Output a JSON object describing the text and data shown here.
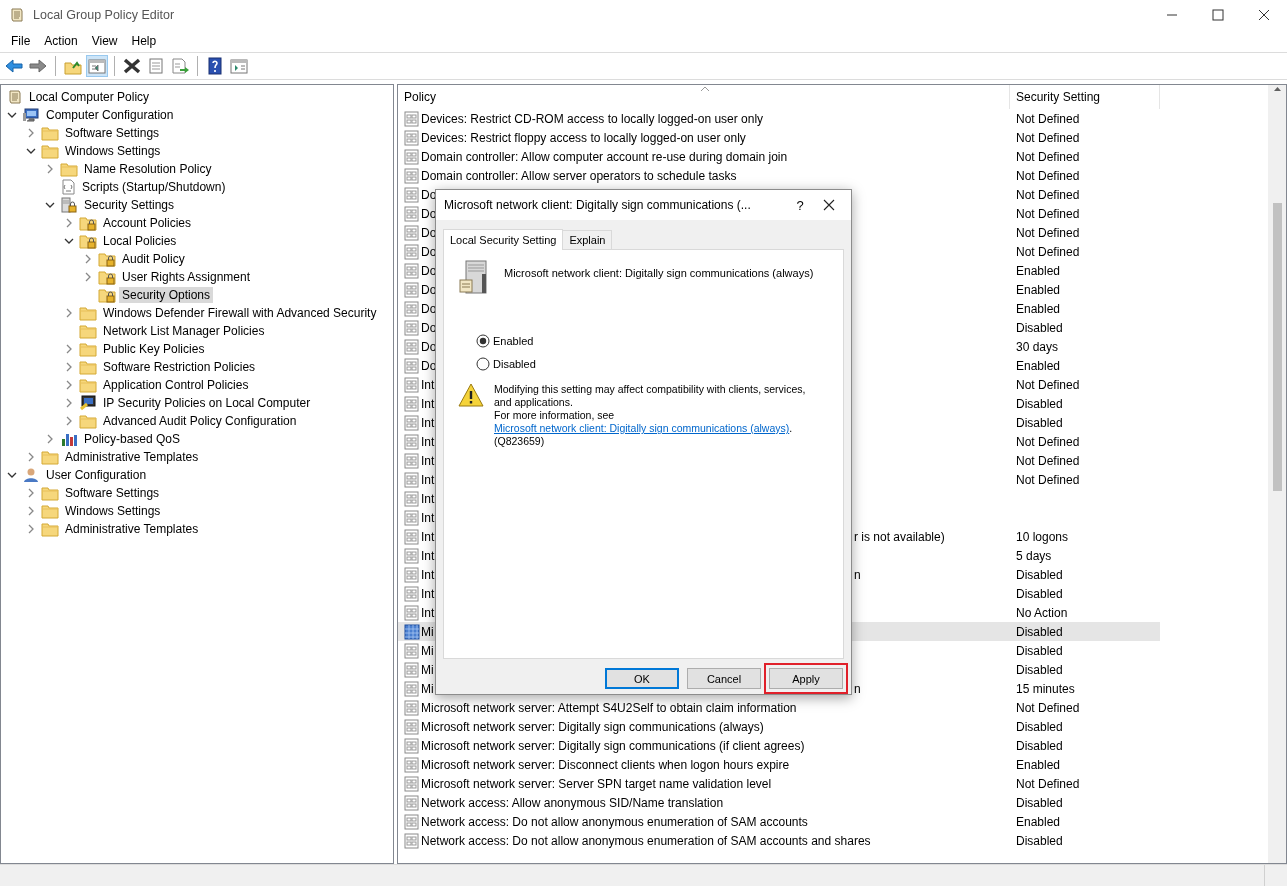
{
  "window": {
    "title": "Local Group Policy Editor"
  },
  "menu": [
    "File",
    "Action",
    "View",
    "Help"
  ],
  "toolbar": [
    [
      {
        "kind": "back",
        "pressed": false
      },
      {
        "kind": "forward",
        "pressed": false
      }
    ],
    [
      {
        "kind": "up",
        "pressed": false
      },
      {
        "kind": "tree",
        "pressed": true
      }
    ],
    [
      {
        "kind": "delete",
        "pressed": false
      },
      {
        "kind": "properties",
        "pressed": false
      },
      {
        "kind": "export",
        "pressed": false
      }
    ],
    [
      {
        "kind": "help",
        "pressed": false
      },
      {
        "kind": "view",
        "pressed": false
      }
    ]
  ],
  "tree": [
    {
      "label": "Local Computer Policy",
      "kind": "policy-root",
      "selected": false,
      "children": [
        {
          "label": "Computer Configuration",
          "kind": "computer",
          "expanded": true,
          "selected": false,
          "children": [
            {
              "label": "Software Settings",
              "kind": "folder",
              "expanded": false,
              "selected": false
            },
            {
              "label": "Windows Settings",
              "kind": "folder",
              "expanded": true,
              "selected": false,
              "children": [
                {
                  "label": "Name Resolution Policy",
                  "kind": "folder",
                  "expanded": false,
                  "selected": false
                },
                {
                  "label": "Scripts (Startup/Shutdown)",
                  "kind": "scripts",
                  "selected": false
                },
                {
                  "label": "Security Settings",
                  "kind": "security",
                  "expanded": true,
                  "selected": false,
                  "children": [
                    {
                      "label": "Account Policies",
                      "kind": "secure-folder",
                      "expanded": false,
                      "selected": false
                    },
                    {
                      "label": "Local Policies",
                      "kind": "secure-folder",
                      "expanded": true,
                      "selected": false,
                      "children": [
                        {
                          "label": "Audit Policy",
                          "kind": "secure-folder",
                          "expanded": false,
                          "selected": false
                        },
                        {
                          "label": "User Rights Assignment",
                          "kind": "secure-folder",
                          "expanded": false,
                          "selected": false
                        },
                        {
                          "label": "Security Options",
                          "kind": "secure-folder",
                          "selected": true
                        }
                      ]
                    },
                    {
                      "label": "Windows Defender Firewall with Advanced Security",
                      "kind": "folder",
                      "expanded": false,
                      "selected": false
                    },
                    {
                      "label": "Network List Manager Policies",
                      "kind": "folder",
                      "selected": false
                    },
                    {
                      "label": "Public Key Policies",
                      "kind": "folder",
                      "expanded": false,
                      "selected": false
                    },
                    {
                      "label": "Software Restriction Policies",
                      "kind": "folder",
                      "expanded": false,
                      "selected": false
                    },
                    {
                      "label": "Application Control Policies",
                      "kind": "folder",
                      "expanded": false,
                      "selected": false
                    },
                    {
                      "label": "IP Security Policies on Local Computer",
                      "kind": "ip-security",
                      "expanded": false,
                      "selected": false
                    },
                    {
                      "label": "Advanced Audit Policy Configuration",
                      "kind": "folder",
                      "expanded": false,
                      "selected": false
                    }
                  ]
                },
                {
                  "label": "Policy-based QoS",
                  "kind": "chart",
                  "expanded": false,
                  "selected": false
                }
              ]
            },
            {
              "label": "Administrative Templates",
              "kind": "folder",
              "expanded": false,
              "selected": false
            }
          ]
        },
        {
          "label": "User Configuration",
          "kind": "user",
          "expanded": true,
          "selected": false,
          "children": [
            {
              "label": "Software Settings",
              "kind": "folder",
              "expanded": false,
              "selected": false
            },
            {
              "label": "Windows Settings",
              "kind": "folder",
              "expanded": false,
              "selected": false
            },
            {
              "label": "Administrative Templates",
              "kind": "folder",
              "expanded": false,
              "selected": false
            }
          ]
        }
      ]
    }
  ],
  "table": {
    "columns": [
      "Policy",
      "Security Setting"
    ],
    "rows": [
      {
        "policy": "Devices: Restrict CD-ROM access to locally logged-on user only",
        "setting": "Not Defined",
        "selected": false
      },
      {
        "policy": "Devices: Restrict floppy access to locally logged-on user only",
        "setting": "Not Defined",
        "selected": false
      },
      {
        "policy": "Domain controller: Allow computer account re-use during domain join",
        "setting": "Not Defined",
        "selected": false
      },
      {
        "policy": "Domain controller: Allow server operators to schedule tasks",
        "setting": "Not Defined",
        "selected": false
      },
      {
        "policy": "Do",
        "setting": "Not Defined",
        "selected": false
      },
      {
        "policy": "Do",
        "setting": "Not Defined",
        "selected": false
      },
      {
        "policy": "Do",
        "setting": "Not Defined",
        "selected": false
      },
      {
        "policy": "Do",
        "setting": "Not Defined",
        "selected": false
      },
      {
        "policy": "Do",
        "setting": "Enabled",
        "selected": false
      },
      {
        "policy": "Do",
        "setting": "Enabled",
        "selected": false
      },
      {
        "policy": "Do",
        "setting": "Enabled",
        "selected": false
      },
      {
        "policy": "Do",
        "setting": "Disabled",
        "selected": false
      },
      {
        "policy": "Do",
        "setting": "30 days",
        "selected": false
      },
      {
        "policy": "Do",
        "setting": "Enabled",
        "selected": false
      },
      {
        "policy": "Int",
        "setting": "Not Defined",
        "selected": false
      },
      {
        "policy": "Int",
        "setting": "Disabled",
        "selected": false
      },
      {
        "policy": "Int",
        "setting": "Disabled",
        "selected": false
      },
      {
        "policy": "Int",
        "setting": "Not Defined",
        "selected": false
      },
      {
        "policy": "Int",
        "setting": "Not Defined",
        "selected": false
      },
      {
        "policy": "Int",
        "setting": "Not Defined",
        "selected": false
      },
      {
        "policy": "Int",
        "selected": false
      },
      {
        "policy": "Int",
        "selected": false
      },
      {
        "policy": "Int",
        "policy_tail": "r is not available)",
        "setting": "10 logons",
        "selected": false
      },
      {
        "policy": "Int",
        "setting": "5 days",
        "selected": false
      },
      {
        "policy": "Int",
        "policy_tail": "n",
        "setting": "Disabled",
        "selected": false
      },
      {
        "policy": "Int",
        "setting": "Disabled",
        "selected": false
      },
      {
        "policy": "Int",
        "setting": "No Action",
        "selected": false
      },
      {
        "policy": "Mi",
        "setting": "Disabled",
        "selected": true
      },
      {
        "policy": "Mi",
        "setting": "Disabled",
        "selected": false
      },
      {
        "policy": "Mi",
        "setting": "Disabled",
        "selected": false
      },
      {
        "policy": "Mi",
        "policy_tail": "n",
        "setting": "15 minutes",
        "selected": false
      },
      {
        "policy": "Microsoft network server: Attempt S4U2Self to obtain claim information",
        "setting": "Not Defined",
        "selected": false
      },
      {
        "policy": "Microsoft network server: Digitally sign communications (always)",
        "setting": "Disabled",
        "selected": false
      },
      {
        "policy": "Microsoft network server: Digitally sign communications (if client agrees)",
        "setting": "Disabled",
        "selected": false
      },
      {
        "policy": "Microsoft network server: Disconnect clients when logon hours expire",
        "setting": "Enabled",
        "selected": false
      },
      {
        "policy": "Microsoft network server: Server SPN target name validation level",
        "setting": "Not Defined",
        "selected": false
      },
      {
        "policy": "Network access: Allow anonymous SID/Name translation",
        "setting": "Disabled",
        "selected": false
      },
      {
        "policy": "Network access: Do not allow anonymous enumeration of SAM accounts",
        "setting": "Enabled",
        "selected": false
      },
      {
        "policy": "Network access: Do not allow anonymous enumeration of SAM accounts and shares",
        "setting": "Disabled",
        "selected": false
      }
    ]
  },
  "dialog": {
    "title": "Microsoft network client: Digitally sign communications (...",
    "help": "?",
    "tabs": [
      {
        "label": "Local Security Setting",
        "selected": true
      },
      {
        "label": "Explain",
        "selected": false
      }
    ],
    "heading": "Microsoft network client: Digitally sign communications (always)",
    "options": [
      {
        "label": "Enabled",
        "selected": true
      },
      {
        "label": "Disabled",
        "selected": false
      }
    ],
    "warning": "Modifying this setting may affect compatibility with clients, services, and applications.",
    "info_prefix": "For more information, see",
    "info_link": "Microsoft network client: Digitally sign communications (always)",
    "info_suffix": ". (Q823659)",
    "buttons": [
      {
        "label": "OK",
        "default": true,
        "highlighted": false
      },
      {
        "label": "Cancel",
        "default": false,
        "highlighted": false
      },
      {
        "label": "Apply",
        "default": false,
        "highlighted": true
      }
    ]
  }
}
